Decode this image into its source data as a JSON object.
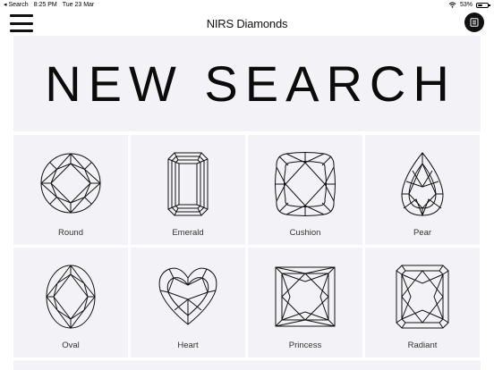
{
  "status_bar": {
    "back_app": "◂ Search",
    "time": "8:25 PM",
    "date": "Tue 23 Mar",
    "battery": "53%",
    "battery_level": 0.53
  },
  "nav": {
    "menu_icon": "hamburger-icon",
    "title": "NIRS Diamonds",
    "action_icon": "list-icon"
  },
  "hero": {
    "title": "NEW SEARCH"
  },
  "shapes": [
    {
      "label": "Round",
      "icon": "round-diamond-icon"
    },
    {
      "label": "Emerald",
      "icon": "emerald-diamond-icon"
    },
    {
      "label": "Cushion",
      "icon": "cushion-diamond-icon"
    },
    {
      "label": "Pear",
      "icon": "pear-diamond-icon"
    },
    {
      "label": "Oval",
      "icon": "oval-diamond-icon"
    },
    {
      "label": "Heart",
      "icon": "heart-diamond-icon"
    },
    {
      "label": "Princess",
      "icon": "princess-diamond-icon"
    },
    {
      "label": "Radiant",
      "icon": "radiant-diamond-icon"
    }
  ]
}
